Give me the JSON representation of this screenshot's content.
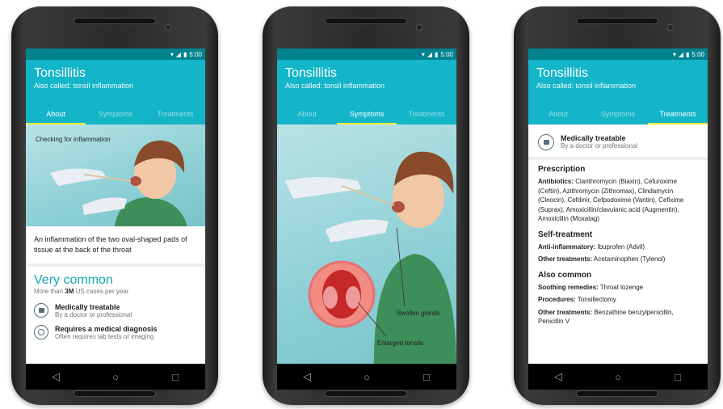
{
  "status": {
    "time": "5:00"
  },
  "app": {
    "title": "Tonsillitis",
    "subtitle": "Also called: tonsil inflammation"
  },
  "tabs": [
    "About",
    "Symptoms",
    "Treatments"
  ],
  "about": {
    "image_caption": "Checking for inflammation",
    "description": "An inflammation of the two oval-shaped pads of tissue at the back of the throat",
    "frequency": "Very common",
    "cases_prefix": "More than ",
    "cases_value": "3M",
    "cases_suffix": " US cases per year",
    "items": [
      {
        "title": "Medically treatable",
        "sub": "By a doctor or professional",
        "icon": "medical-kit-icon"
      },
      {
        "title": "Requires a medical diagnosis",
        "sub": "Often requires lab tests or imaging",
        "icon": "stethoscope-icon"
      }
    ]
  },
  "symptoms": {
    "label_glands": "Swollen glands",
    "label_tonsils": "Enlarged tonsils"
  },
  "treatments": {
    "treatable_title": "Medically treatable",
    "treatable_sub": "By a doctor or professional",
    "sections": [
      {
        "heading": "Prescription",
        "lines": [
          {
            "label": "Antibiotics:",
            "text": " Clarithromycin (Biaxin), Cefuroxime (Ceftin), Azithromycin (Zithromax), Clindamycin (Cleocin), Cefdinir, Cefpodoxime (Vantin), Cefixime (Suprax), Amoxicillin/clavulanic acid (Augmentin), Amoxicillin (Moxatag)"
          }
        ]
      },
      {
        "heading": "Self-treatment",
        "lines": [
          {
            "label": "Anti-inflammatory:",
            "text": " Ibuprofen (Advil)"
          },
          {
            "label": "Other treatments:",
            "text": " Acetaminophen (Tylenol)"
          }
        ]
      },
      {
        "heading": "Also common",
        "lines": [
          {
            "label": "Soothing remedies:",
            "text": " Throat lozenge"
          },
          {
            "label": "Procedures:",
            "text": " Tonsillectomy"
          },
          {
            "label": "Other treatments:",
            "text": " Benzathine benzylpenicillin, Penicillin V"
          }
        ]
      }
    ]
  },
  "nav": {
    "back": "◁",
    "home": "○",
    "recents": "□"
  }
}
